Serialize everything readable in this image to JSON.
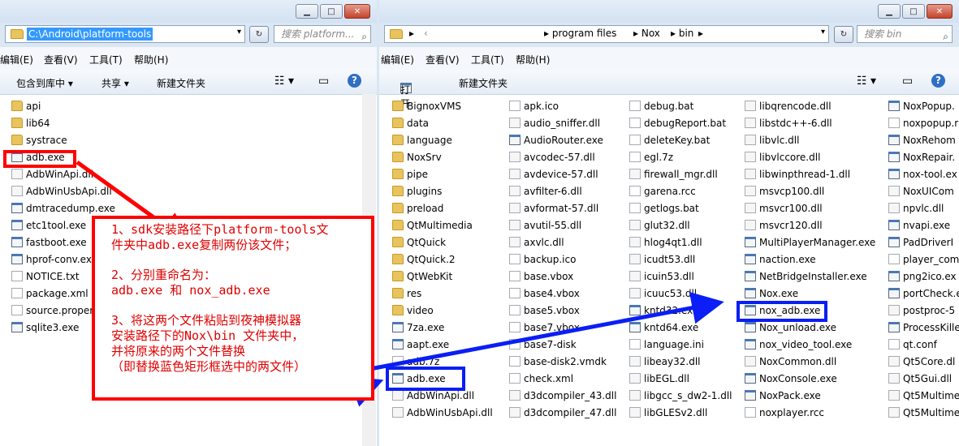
{
  "left_window": {
    "address": "C:\\Android\\platform-tools",
    "search_placeholder": "搜索 platform...",
    "menu": [
      "编辑(E)",
      "查看(V)",
      "工具(T)",
      "帮助(H)"
    ],
    "toolbar": [
      "包含到库中 ▾",
      "共享 ▾",
      "新建文件夹"
    ],
    "files": [
      {
        "name": "api",
        "type": "folder"
      },
      {
        "name": "lib64",
        "type": "folder"
      },
      {
        "name": "systrace",
        "type": "folder"
      },
      {
        "name": "adb.exe",
        "type": "exe"
      },
      {
        "name": "AdbWinApi.dll",
        "type": "dll"
      },
      {
        "name": "AdbWinUsbApi.dll",
        "type": "dll"
      },
      {
        "name": "dmtracedump.exe",
        "type": "exe"
      },
      {
        "name": "etc1tool.exe",
        "type": "exe"
      },
      {
        "name": "fastboot.exe",
        "type": "exe"
      },
      {
        "name": "hprof-conv.exe",
        "type": "exe"
      },
      {
        "name": "NOTICE.txt",
        "type": "file"
      },
      {
        "name": "package.xml",
        "type": "file"
      },
      {
        "name": "source.properties",
        "type": "file"
      },
      {
        "name": "sqlite3.exe",
        "type": "exe"
      }
    ]
  },
  "right_window": {
    "breadcrumb": [
      "▸",
      "‹",
      "▸ program files",
      "▸ Nox",
      "▸ bin",
      "▸"
    ],
    "search_placeholder": "搜索 bin",
    "menu": [
      "编辑(E)",
      "查看(V)",
      "工具(T)",
      "帮助(H)"
    ],
    "toolbar": [
      "打开",
      "新建文件夹"
    ],
    "columns": [
      [
        {
          "name": "BignoxVMS",
          "type": "folder"
        },
        {
          "name": "data",
          "type": "folder"
        },
        {
          "name": "language",
          "type": "folder"
        },
        {
          "name": "NoxSrv",
          "type": "folder"
        },
        {
          "name": "pipe",
          "type": "folder"
        },
        {
          "name": "plugins",
          "type": "folder"
        },
        {
          "name": "preload",
          "type": "folder"
        },
        {
          "name": "QtMultimedia",
          "type": "folder"
        },
        {
          "name": "QtQuick",
          "type": "folder"
        },
        {
          "name": "QtQuick.2",
          "type": "folder"
        },
        {
          "name": "QtWebKit",
          "type": "folder"
        },
        {
          "name": "res",
          "type": "folder"
        },
        {
          "name": "video",
          "type": "folder"
        },
        {
          "name": "7za.exe",
          "type": "exe"
        },
        {
          "name": "aapt.exe",
          "type": "exe"
        },
        {
          "name": "adb.7z",
          "type": "file"
        },
        {
          "name": "adb.exe",
          "type": "exe"
        },
        {
          "name": "AdbWinApi.dll",
          "type": "dll"
        },
        {
          "name": "AdbWinUsbApi.dll",
          "type": "dll"
        }
      ],
      [
        {
          "name": "apk.ico",
          "type": "file"
        },
        {
          "name": "audio_sniffer.dll",
          "type": "dll"
        },
        {
          "name": "AudioRouter.exe",
          "type": "exe"
        },
        {
          "name": "avcodec-57.dll",
          "type": "dll"
        },
        {
          "name": "avdevice-57.dll",
          "type": "dll"
        },
        {
          "name": "avfilter-6.dll",
          "type": "dll"
        },
        {
          "name": "avformat-57.dll",
          "type": "dll"
        },
        {
          "name": "avutil-55.dll",
          "type": "dll"
        },
        {
          "name": "axvlc.dll",
          "type": "dll"
        },
        {
          "name": "backup.ico",
          "type": "file"
        },
        {
          "name": "base.vbox",
          "type": "file"
        },
        {
          "name": "base4.vbox",
          "type": "file"
        },
        {
          "name": "base5.vbox",
          "type": "file"
        },
        {
          "name": "base7.vbox",
          "type": "file"
        },
        {
          "name": "base7-disk",
          "type": "file"
        },
        {
          "name": "base-disk2.vmdk",
          "type": "file"
        },
        {
          "name": "check.xml",
          "type": "file"
        },
        {
          "name": "d3dcompiler_43.dll",
          "type": "dll"
        },
        {
          "name": "d3dcompiler_47.dll",
          "type": "dll"
        }
      ],
      [
        {
          "name": "debug.bat",
          "type": "file"
        },
        {
          "name": "debugReport.bat",
          "type": "file"
        },
        {
          "name": "deleteKey.bat",
          "type": "file"
        },
        {
          "name": "egl.7z",
          "type": "file"
        },
        {
          "name": "firewall_mgr.dll",
          "type": "dll"
        },
        {
          "name": "garena.rcc",
          "type": "file"
        },
        {
          "name": "getlogs.bat",
          "type": "file"
        },
        {
          "name": "glut32.dll",
          "type": "dll"
        },
        {
          "name": "hlog4qt1.dll",
          "type": "dll"
        },
        {
          "name": "icudt53.dll",
          "type": "dll"
        },
        {
          "name": "icuin53.dll",
          "type": "dll"
        },
        {
          "name": "icuuc53.dll",
          "type": "dll"
        },
        {
          "name": "kntd32.exe",
          "type": "exe"
        },
        {
          "name": "kntd64.exe",
          "type": "exe"
        },
        {
          "name": "language.ini",
          "type": "file"
        },
        {
          "name": "libeay32.dll",
          "type": "dll"
        },
        {
          "name": "libEGL.dll",
          "type": "dll"
        },
        {
          "name": "libgcc_s_dw2-1.dll",
          "type": "dll"
        },
        {
          "name": "libGLESv2.dll",
          "type": "dll"
        }
      ],
      [
        {
          "name": "libqrencode.dll",
          "type": "dll"
        },
        {
          "name": "libstdc++-6.dll",
          "type": "dll"
        },
        {
          "name": "libvlc.dll",
          "type": "dll"
        },
        {
          "name": "libvlccore.dll",
          "type": "dll"
        },
        {
          "name": "libwinpthread-1.dll",
          "type": "dll"
        },
        {
          "name": "msvcp100.dll",
          "type": "dll"
        },
        {
          "name": "msvcr100.dll",
          "type": "dll"
        },
        {
          "name": "msvcr120.dll",
          "type": "dll"
        },
        {
          "name": "MultiPlayerManager.exe",
          "type": "exe"
        },
        {
          "name": "naction.exe",
          "type": "exe"
        },
        {
          "name": "NetBridgeInstaller.exe",
          "type": "exe"
        },
        {
          "name": "Nox.exe",
          "type": "exe"
        },
        {
          "name": "nox_adb.exe",
          "type": "exe"
        },
        {
          "name": "Nox_unload.exe",
          "type": "exe"
        },
        {
          "name": "nox_video_tool.exe",
          "type": "exe"
        },
        {
          "name": "NoxCommon.dll",
          "type": "dll"
        },
        {
          "name": "NoxConsole.exe",
          "type": "exe"
        },
        {
          "name": "NoxPack.exe",
          "type": "exe"
        },
        {
          "name": "noxplayer.rcc",
          "type": "file"
        }
      ],
      [
        {
          "name": "NoxPopup.",
          "type": "exe"
        },
        {
          "name": "noxpopup.r",
          "type": "file"
        },
        {
          "name": "NoxRehom",
          "type": "exe"
        },
        {
          "name": "NoxRepair.",
          "type": "exe"
        },
        {
          "name": "nox-tool.ex",
          "type": "exe"
        },
        {
          "name": "NoxUICom",
          "type": "dll"
        },
        {
          "name": "npvlc.dll",
          "type": "dll"
        },
        {
          "name": "nvapi.exe",
          "type": "exe"
        },
        {
          "name": "PadDriverI",
          "type": "exe"
        },
        {
          "name": "player_com",
          "type": "file"
        },
        {
          "name": "png2ico.ex",
          "type": "exe"
        },
        {
          "name": "portCheck.e",
          "type": "exe"
        },
        {
          "name": "postproc-5",
          "type": "dll"
        },
        {
          "name": "ProcessKille",
          "type": "exe"
        },
        {
          "name": "qt.conf",
          "type": "file"
        },
        {
          "name": "Qt5Core.dl",
          "type": "dll"
        },
        {
          "name": "Qt5Gui.dll",
          "type": "dll"
        },
        {
          "name": "Qt5Multime",
          "type": "dll"
        },
        {
          "name": "Qt5Multime",
          "type": "dll"
        }
      ]
    ]
  },
  "annotation": {
    "step1_line1": "1、sdk安装路径下platform-tools文",
    "step1_line2": "件夹中adb.exe复制两份该文件；",
    "step2_line1": "2、分别重命名为：",
    "step2_line2": "adb.exe 和 nox_adb.exe",
    "step3_line1": "3、将这两个文件粘贴到夜神模拟器",
    "step3_line2": "安装路径下的Nox\\bin 文件夹中，",
    "step3_line3": "并将原来的两个文件替换",
    "step3_line4": "（即替换蓝色矩形框选中的两文件）",
    "red_color": "#ff0000",
    "blue_color": "#0a1ef5"
  }
}
